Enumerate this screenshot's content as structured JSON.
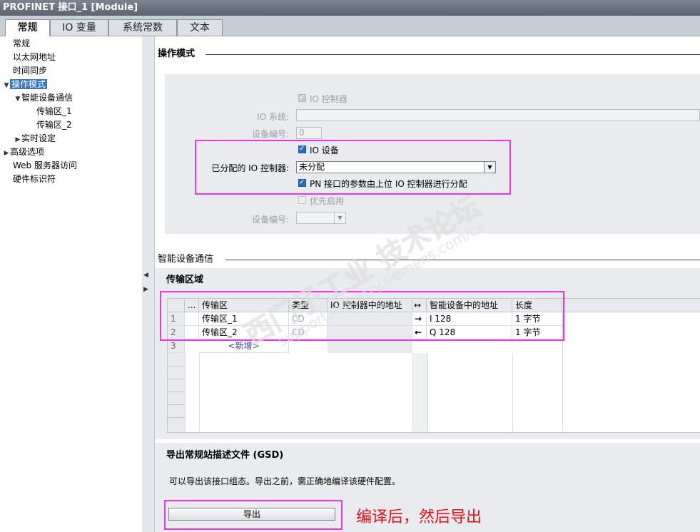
{
  "window": {
    "title": "PROFINET 接口_1 [Module]"
  },
  "tabs": [
    {
      "label": "常规"
    },
    {
      "label": "IO 变量"
    },
    {
      "label": "系统常数"
    },
    {
      "label": "文本"
    }
  ],
  "nav": {
    "items": [
      {
        "label": "常规"
      },
      {
        "label": "以太网地址"
      },
      {
        "label": "时间同步"
      },
      {
        "label": "操作模式"
      },
      {
        "label": "智能设备通信"
      },
      {
        "label": "传输区_1"
      },
      {
        "label": "传输区_2"
      },
      {
        "label": "实时设定"
      },
      {
        "label": "高级选项"
      },
      {
        "label": "Web 服务器访问"
      },
      {
        "label": "硬件标识符"
      }
    ]
  },
  "op_mode": {
    "title": "操作模式",
    "io_controller_label": "IO 控制器",
    "io_system_label": "IO 系统:",
    "device_number_label": "设备编号:",
    "device_number_value": "0",
    "io_device_label": "IO 设备",
    "assigned_controller_label": "已分配的 IO 控制器:",
    "assigned_controller_value": "未分配",
    "pn_param_label": "PN 接口的参数由上位 IO 控制器进行分配",
    "priority_startup_label": "优先启用",
    "device_number2_label": "设备编号:"
  },
  "idevice": {
    "title": "智能设备通信",
    "transfer_title": "传输区域",
    "columns": [
      "...",
      "传输区",
      "类型",
      "IO 控制器中的地址",
      "↔",
      "智能设备中的地址",
      "长度"
    ],
    "rows": [
      {
        "num": "1",
        "name": "传输区_1",
        "type": "CD",
        "ctrl_addr": "",
        "dir": "→",
        "dev_addr": "I 128",
        "length": "1 字节"
      },
      {
        "num": "2",
        "name": "传输区_2",
        "type": "CD",
        "ctrl_addr": "",
        "dir": "←",
        "dev_addr": "Q 128",
        "length": "1 字节"
      }
    ],
    "new_row_num": "3",
    "new_row_label": "<新增>"
  },
  "gsd": {
    "title": "导出常规站描述文件 (GSD)",
    "description": "可以导出该接口组态。导出之前，需正确地编译该硬件配置。",
    "export_button": "导出",
    "annotation": "编译后，然后导出"
  },
  "watermark": {
    "text1": "西门子工业  技术论坛",
    "text2": "support.industry.siemens.com/cs"
  },
  "colors": {
    "highlight_box": "#ee33ee",
    "annotation_red": "#e8101a",
    "selection_blue": "#3874c8"
  }
}
